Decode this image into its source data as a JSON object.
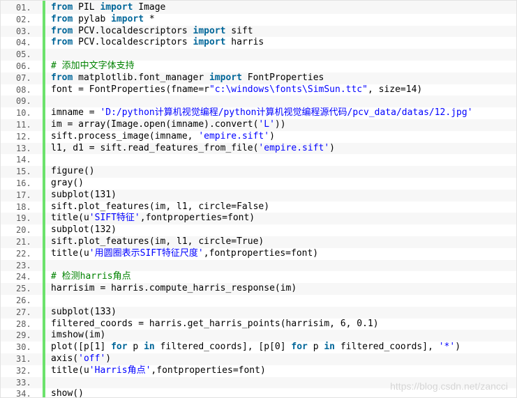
{
  "watermark": "https://blog.csdn.net/zancci",
  "lines": [
    {
      "n": "01.",
      "tokens": [
        {
          "t": "from",
          "c": "kw"
        },
        {
          "t": " PIL "
        },
        {
          "t": "import",
          "c": "kw"
        },
        {
          "t": " Image"
        }
      ]
    },
    {
      "n": "02.",
      "tokens": [
        {
          "t": "from",
          "c": "kw"
        },
        {
          "t": " pylab "
        },
        {
          "t": "import",
          "c": "kw"
        },
        {
          "t": " *"
        }
      ]
    },
    {
      "n": "03.",
      "tokens": [
        {
          "t": "from",
          "c": "kw"
        },
        {
          "t": " PCV.localdescriptors "
        },
        {
          "t": "import",
          "c": "kw"
        },
        {
          "t": " sift"
        }
      ]
    },
    {
      "n": "04.",
      "tokens": [
        {
          "t": "from",
          "c": "kw"
        },
        {
          "t": " PCV.localdescriptors "
        },
        {
          "t": "import",
          "c": "kw"
        },
        {
          "t": " harris"
        }
      ]
    },
    {
      "n": "05.",
      "tokens": []
    },
    {
      "n": "06.",
      "tokens": [
        {
          "t": "# 添加中文字体支持",
          "c": "cmt"
        }
      ]
    },
    {
      "n": "07.",
      "tokens": [
        {
          "t": "from",
          "c": "kw"
        },
        {
          "t": " matplotlib.font_manager "
        },
        {
          "t": "import",
          "c": "kw"
        },
        {
          "t": " FontProperties"
        }
      ]
    },
    {
      "n": "08.",
      "tokens": [
        {
          "t": "font = FontProperties(fname=r"
        },
        {
          "t": "\"c:\\windows\\fonts\\SimSun.ttc\"",
          "c": "str"
        },
        {
          "t": ", size=14)"
        }
      ]
    },
    {
      "n": "09.",
      "tokens": []
    },
    {
      "n": "10.",
      "tokens": [
        {
          "t": "imname = "
        },
        {
          "t": "'D:/python计算机视觉编程/python计算机视觉编程源代码/pcv_data/datas/12.jpg'",
          "c": "str"
        }
      ]
    },
    {
      "n": "11.",
      "tokens": [
        {
          "t": "im = array(Image.open(imname).convert("
        },
        {
          "t": "'L'",
          "c": "str"
        },
        {
          "t": "))"
        }
      ]
    },
    {
      "n": "12.",
      "tokens": [
        {
          "t": "sift.process_image(imname, "
        },
        {
          "t": "'empire.sift'",
          "c": "str"
        },
        {
          "t": ")"
        }
      ]
    },
    {
      "n": "13.",
      "tokens": [
        {
          "t": "l1, d1 = sift.read_features_from_file("
        },
        {
          "t": "'empire.sift'",
          "c": "str"
        },
        {
          "t": ")"
        }
      ]
    },
    {
      "n": "14.",
      "tokens": []
    },
    {
      "n": "15.",
      "tokens": [
        {
          "t": "figure()"
        }
      ]
    },
    {
      "n": "16.",
      "tokens": [
        {
          "t": "gray()"
        }
      ]
    },
    {
      "n": "17.",
      "tokens": [
        {
          "t": "subplot(131)"
        }
      ]
    },
    {
      "n": "18.",
      "tokens": [
        {
          "t": "sift.plot_features(im, l1, circle=False)"
        }
      ]
    },
    {
      "n": "19.",
      "tokens": [
        {
          "t": "title(u"
        },
        {
          "t": "'SIFT特征'",
          "c": "str"
        },
        {
          "t": ",fontproperties=font)"
        }
      ]
    },
    {
      "n": "20.",
      "tokens": [
        {
          "t": "subplot(132)"
        }
      ]
    },
    {
      "n": "21.",
      "tokens": [
        {
          "t": "sift.plot_features(im, l1, circle=True)"
        }
      ]
    },
    {
      "n": "22.",
      "tokens": [
        {
          "t": "title(u"
        },
        {
          "t": "'用圆圈表示SIFT特征尺度'",
          "c": "str"
        },
        {
          "t": ",fontproperties=font)"
        }
      ]
    },
    {
      "n": "23.",
      "tokens": []
    },
    {
      "n": "24.",
      "tokens": [
        {
          "t": "# 检测harris角点",
          "c": "cmt"
        }
      ]
    },
    {
      "n": "25.",
      "tokens": [
        {
          "t": "harrisim = harris.compute_harris_response(im)"
        }
      ]
    },
    {
      "n": "26.",
      "tokens": []
    },
    {
      "n": "27.",
      "tokens": [
        {
          "t": "subplot(133)"
        }
      ]
    },
    {
      "n": "28.",
      "tokens": [
        {
          "t": "filtered_coords = harris.get_harris_points(harrisim, 6, 0.1)"
        }
      ]
    },
    {
      "n": "29.",
      "tokens": [
        {
          "t": "imshow(im)"
        }
      ]
    },
    {
      "n": "30.",
      "tokens": [
        {
          "t": "plot([p[1] "
        },
        {
          "t": "for",
          "c": "kw"
        },
        {
          "t": " p "
        },
        {
          "t": "in",
          "c": "kw"
        },
        {
          "t": " filtered_coords], [p[0] "
        },
        {
          "t": "for",
          "c": "kw"
        },
        {
          "t": " p "
        },
        {
          "t": "in",
          "c": "kw"
        },
        {
          "t": " filtered_coords], "
        },
        {
          "t": "'*'",
          "c": "str"
        },
        {
          "t": ")"
        }
      ]
    },
    {
      "n": "31.",
      "tokens": [
        {
          "t": "axis("
        },
        {
          "t": "'off'",
          "c": "str"
        },
        {
          "t": ")"
        }
      ]
    },
    {
      "n": "32.",
      "tokens": [
        {
          "t": "title(u"
        },
        {
          "t": "'Harris角点'",
          "c": "str"
        },
        {
          "t": ",fontproperties=font)"
        }
      ]
    },
    {
      "n": "33.",
      "tokens": []
    },
    {
      "n": "34.",
      "tokens": [
        {
          "t": "show()"
        }
      ]
    }
  ]
}
